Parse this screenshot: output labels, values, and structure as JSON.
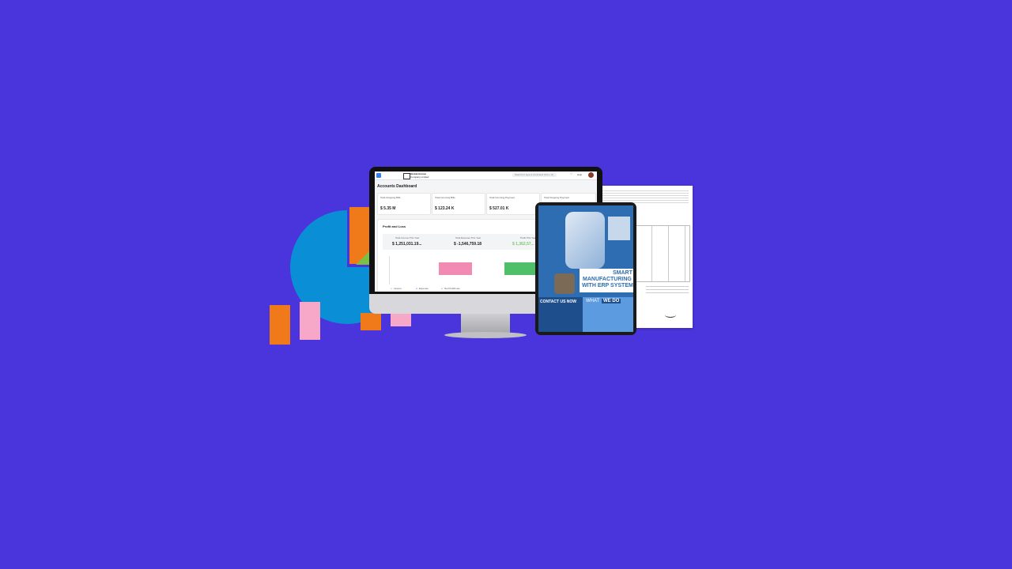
{
  "dashboard": {
    "title": "Accounts Dashboard",
    "search_placeholder": "Search or type a command (Ctrl + G)",
    "help_label": "Help",
    "company_name": "Global Homes",
    "company_sub": "Company Limited",
    "kpis": [
      {
        "label": "Total Outgoing Bills",
        "value": "$ 5.35 M"
      },
      {
        "label": "Total Incoming Bills",
        "value": "$ 123.24 K"
      },
      {
        "label": "Total Incoming Payment",
        "value": "$ 527.01 K"
      },
      {
        "label": "Total Outgoing Payment",
        "value": ""
      }
    ],
    "pl_title": "Profit and Loss",
    "pl_stats": [
      {
        "label": "Total Income This Year",
        "value": "$ 1,251,031.19..."
      },
      {
        "label": "Total Expense This Year",
        "value": "$ -1,546,759.18"
      },
      {
        "label": "Profit This Year",
        "value": "$ 1,362,57..."
      }
    ],
    "legend": [
      "Income",
      "Expense",
      "Net Profit/Loss"
    ]
  },
  "brochure": {
    "headline_1": "SMART",
    "headline_2": "MANUFACTURING",
    "headline_3": "WITH ERP SYSTEM",
    "contact_title": "CONTACT US NOW",
    "what_label": "WHAT",
    "we_do_label": "WE DO"
  },
  "colors": {
    "background": "#4a34dc",
    "pie": "#0a8fd6",
    "orange": "#f07a1a",
    "pink": "#f7a8c8",
    "green": "#7bc043"
  }
}
